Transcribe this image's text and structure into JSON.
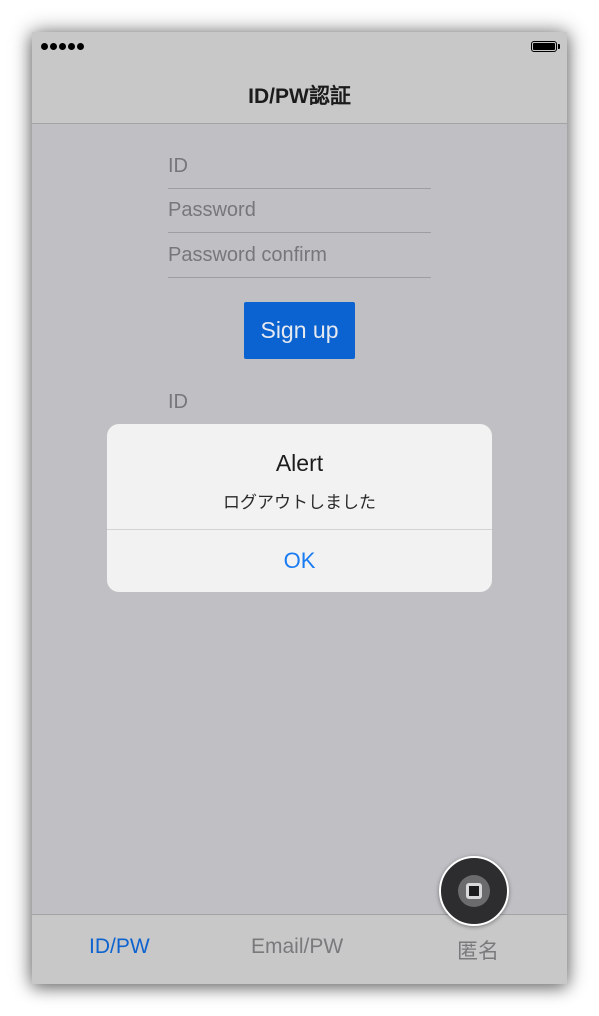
{
  "nav": {
    "title": "ID/PW認証"
  },
  "signup_form": {
    "id_placeholder": "ID",
    "password_placeholder": "Password",
    "password_confirm_placeholder": "Password confirm",
    "signup_label": "Sign up"
  },
  "login_form": {
    "id_placeholder": "ID"
  },
  "alert": {
    "title": "Alert",
    "message": "ログアウトしました",
    "ok_label": "OK"
  },
  "tabs": [
    {
      "label": "ID/PW",
      "active": true
    },
    {
      "label": "Email/PW",
      "active": false
    },
    {
      "label": "匿名",
      "active": false
    }
  ],
  "colors": {
    "accent": "#0a63d0",
    "alert_button": "#1a7cf2",
    "background": "#c0bfc4"
  },
  "icons": {
    "assistive_touch": "assistive-touch-icon",
    "signal": "signal-dots-icon",
    "battery": "battery-icon"
  }
}
